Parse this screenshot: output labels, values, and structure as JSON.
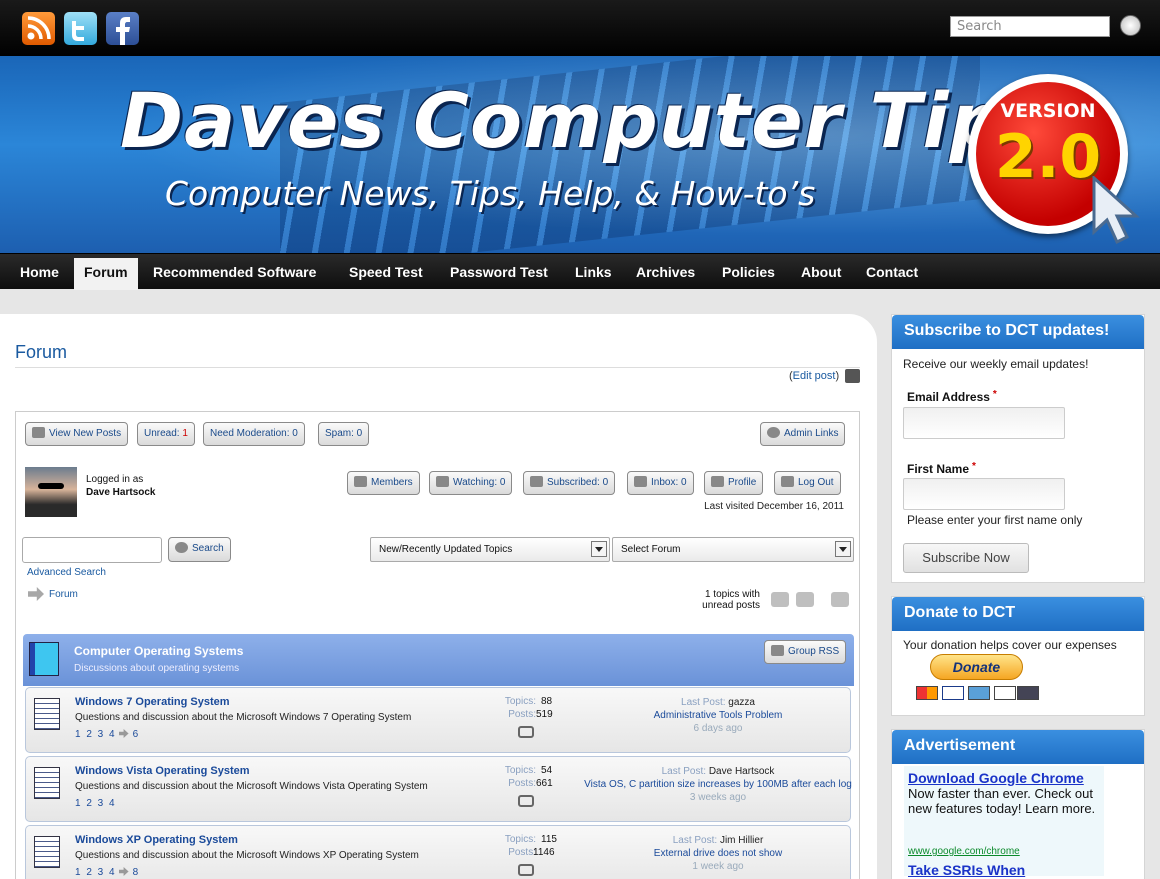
{
  "top": {
    "search_placeholder": "Search"
  },
  "banner": {
    "title": "Daves Computer Tips",
    "tagline": "Computer News, Tips, Help, & How-to’s",
    "badge_label": "VERSION",
    "badge_number": "2.0"
  },
  "nav": {
    "items": [
      "Home",
      "Forum",
      "Recommended Software",
      "Speed Test",
      "Password Test",
      "Links",
      "Archives",
      "Policies",
      "About",
      "Contact"
    ],
    "active": "Forum"
  },
  "forum": {
    "page_title": "Forum",
    "edit_open": "(",
    "edit_link": "Edit post",
    "edit_close": ")",
    "buttons": {
      "view_new_posts": "View New Posts",
      "unread_label": "Unread:",
      "unread_count": "1",
      "need_moderation": "Need Moderation: 0",
      "spam": "Spam: 0",
      "admin_links": "Admin Links",
      "members": "Members",
      "watching": "Watching: 0",
      "subscribed": "Subscribed: 0",
      "inbox": "Inbox: 0",
      "profile": "Profile",
      "log_out": "Log Out",
      "search": "Search",
      "group_rss": "Group RSS"
    },
    "logged_in_label": "Logged in as",
    "user_name": "Dave Hartsock",
    "last_visited": "Last visited December 16, 2011",
    "advanced_search": "Advanced Search",
    "topic_select": "New/Recently Updated Topics",
    "forum_select": "Select Forum",
    "breadcrumb": "Forum",
    "unread_topics": "1 topics with unread posts",
    "group": {
      "title": "Computer Operating Systems",
      "description": "Discussions about operating systems"
    },
    "topics_label": "Topics:",
    "posts_label": "Posts:",
    "last_post_label": "Last Post:",
    "rows": [
      {
        "name": "Windows 7 Operating System",
        "description": "Questions and discussion about the Microsoft Windows 7 Operating System",
        "pages_a": "1 2 3 4",
        "pages_b": "6",
        "topics": "88",
        "posts": "519",
        "last_user": "gazza",
        "last_topic": "Administrative Tools Problem",
        "last_ago": "6 days ago"
      },
      {
        "name": "Windows Vista Operating System",
        "description": "Questions and discussion about the Microsoft Windows Vista Operating System",
        "pages_a": "1 2 3 4",
        "pages_b": "",
        "topics": "54",
        "posts": "661",
        "last_user": "Dave Hartsock",
        "last_topic": "Vista OS, C partition size increases by 100MB after each log",
        "last_ago": "3 weeks ago"
      },
      {
        "name": "Windows XP Operating System",
        "description": "Questions and discussion about the Microsoft Windows XP Operating System",
        "pages_a": "1 2 3 4",
        "pages_b": "8",
        "topics": "115",
        "posts": "1146",
        "last_user": "Jim Hillier",
        "last_topic": "External drive does not show",
        "last_ago": "1 week ago"
      }
    ]
  },
  "sidebar": {
    "subscribe": {
      "title": "Subscribe to DCT updates!",
      "intro": "Receive our weekly email updates!",
      "email_label": "Email Address",
      "first_name_label": "First Name",
      "required_mark": "*",
      "hint": "Please enter your first name only",
      "button": "Subscribe Now"
    },
    "donate": {
      "title": "Donate to DCT",
      "text": "Your donation helps cover our expenses",
      "button": "Donate"
    },
    "ad": {
      "title": "Advertisement",
      "link1": "Download Google Chrome",
      "body": "Now faster than ever. Check out new features today! Learn more.",
      "url": "www.google.com/chrome",
      "link2": "Take SSRIs When"
    }
  },
  "colors": {
    "accent_blue": "#1f6fc4",
    "link_blue": "#1a4a9a",
    "group_header": "#7a9fe0",
    "badge_red": "#c40000"
  }
}
